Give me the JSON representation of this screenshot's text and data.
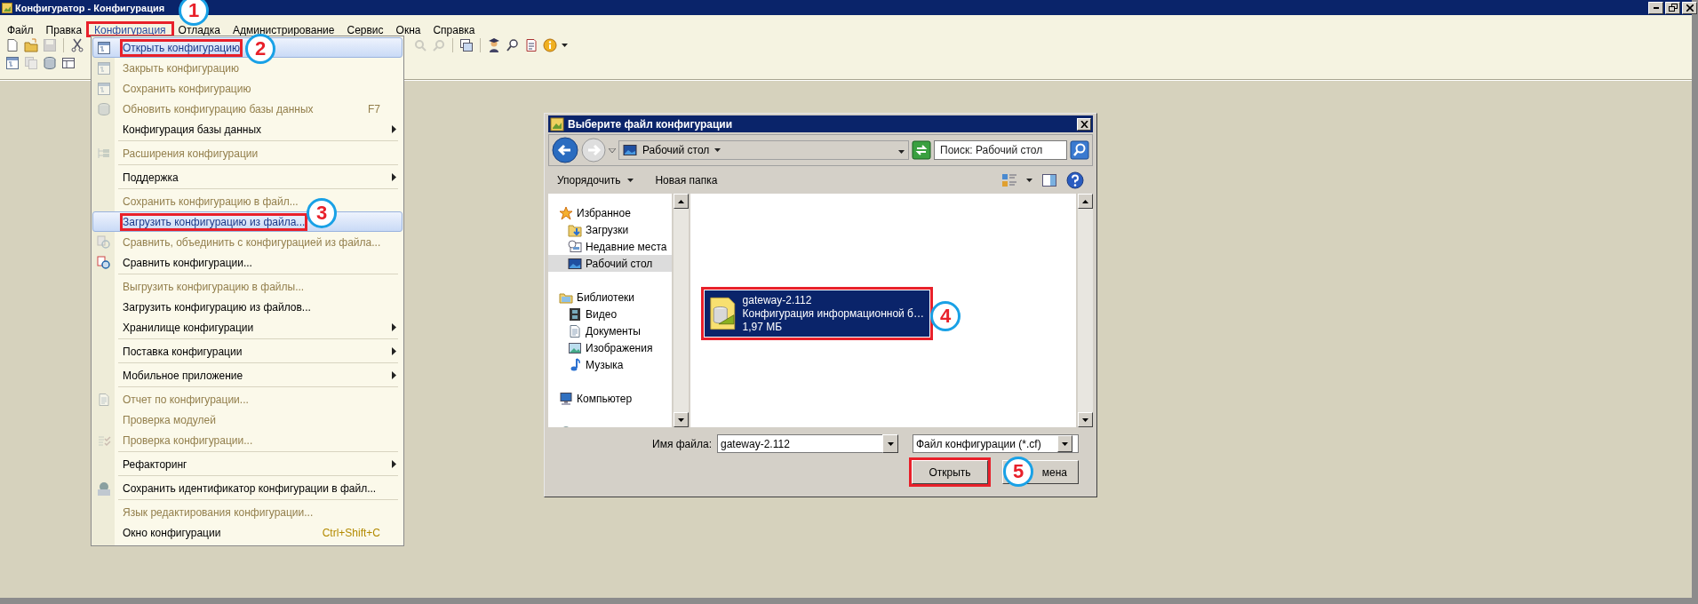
{
  "window": {
    "title": "Конфигуратор - Конфигурация"
  },
  "menu_bar": [
    {
      "label": "Файл",
      "selected": false,
      "outlined": false
    },
    {
      "label": "Правка",
      "selected": false,
      "outlined": false
    },
    {
      "label": "Конфигурация",
      "selected": true,
      "outlined": true
    },
    {
      "label": "Отладка",
      "selected": false,
      "outlined": false
    },
    {
      "label": "Администрирование",
      "selected": false,
      "outlined": false
    },
    {
      "label": "Сервис",
      "selected": false,
      "outlined": false
    },
    {
      "label": "Окна",
      "selected": false,
      "outlined": false
    },
    {
      "label": "Справка",
      "selected": false,
      "outlined": false
    }
  ],
  "config_menu": {
    "items": [
      {
        "kind": "item",
        "label": "Открыть конфигурацию",
        "disabled": false,
        "selected": true,
        "outlined": true
      },
      {
        "kind": "item",
        "label": "Закрыть конфигурацию",
        "disabled": true,
        "selected": false,
        "outlined": false
      },
      {
        "kind": "item",
        "label": "Сохранить конфигурацию",
        "disabled": true,
        "selected": false,
        "outlined": false
      },
      {
        "kind": "item",
        "label": "Обновить конфигурацию базы данных",
        "shortcut": "F7",
        "disabled": true,
        "selected": false,
        "outlined": false
      },
      {
        "kind": "submenu",
        "label": "Конфигурация базы данных",
        "disabled": false,
        "selected": false,
        "outlined": false
      },
      {
        "kind": "separator"
      },
      {
        "kind": "item",
        "label": "Расширения конфигурации",
        "disabled": true,
        "selected": false,
        "outlined": false
      },
      {
        "kind": "separator"
      },
      {
        "kind": "submenu",
        "label": "Поддержка",
        "disabled": false,
        "selected": false,
        "outlined": false
      },
      {
        "kind": "separator"
      },
      {
        "kind": "item",
        "label": "Сохранить конфигурацию в файл...",
        "disabled": true,
        "selected": false,
        "outlined": false
      },
      {
        "kind": "item",
        "label": "Загрузить конфигурацию из файла...",
        "disabled": false,
        "selected": true,
        "outlined": true
      },
      {
        "kind": "item",
        "label": "Сравнить, объединить с конфигурацией из файла...",
        "disabled": true,
        "selected": false,
        "outlined": false
      },
      {
        "kind": "item",
        "label": "Сравнить конфигурации...",
        "disabled": false,
        "selected": false,
        "outlined": false
      },
      {
        "kind": "separator"
      },
      {
        "kind": "item",
        "label": "Выгрузить конфигурацию в файлы...",
        "disabled": true,
        "selected": false,
        "outlined": false
      },
      {
        "kind": "item",
        "label": "Загрузить конфигурацию из файлов...",
        "disabled": false,
        "selected": false,
        "outlined": false
      },
      {
        "kind": "submenu",
        "label": "Хранилище конфигурации",
        "disabled": false,
        "selected": false,
        "outlined": false
      },
      {
        "kind": "separator"
      },
      {
        "kind": "submenu",
        "label": "Поставка конфигурации",
        "disabled": false,
        "selected": false,
        "outlined": false
      },
      {
        "kind": "separator"
      },
      {
        "kind": "submenu",
        "label": "Мобильное приложение",
        "disabled": false,
        "selected": false,
        "outlined": false
      },
      {
        "kind": "separator"
      },
      {
        "kind": "item",
        "label": "Отчет по конфигурации...",
        "disabled": true,
        "selected": false,
        "outlined": false
      },
      {
        "kind": "item",
        "label": "Проверка модулей",
        "disabled": true,
        "selected": false,
        "outlined": false
      },
      {
        "kind": "item",
        "label": "Проверка конфигурации...",
        "disabled": true,
        "selected": false,
        "outlined": false
      },
      {
        "kind": "separator"
      },
      {
        "kind": "submenu",
        "label": "Рефакторинг",
        "disabled": false,
        "selected": false,
        "outlined": false
      },
      {
        "kind": "separator"
      },
      {
        "kind": "item",
        "label": "Сохранить идентификатор конфигурации в файл...",
        "disabled": false,
        "selected": false,
        "outlined": false
      },
      {
        "kind": "separator"
      },
      {
        "kind": "item",
        "label": "Язык редактирования конфигурации...",
        "disabled": true,
        "selected": false,
        "outlined": false
      },
      {
        "kind": "item",
        "label": "Окно конфигурации",
        "shortcut": "Ctrl+Shift+C",
        "disabled": false,
        "selected": false,
        "outlined": false
      }
    ]
  },
  "dialog": {
    "title": "Выберите файл конфигурации",
    "location": "Рабочий стол",
    "search": {
      "placeholder": "Поиск: Рабочий стол"
    },
    "commands": [
      {
        "label": "Упорядочить",
        "dropdown": true
      },
      {
        "label": "Новая папка",
        "dropdown": false
      }
    ],
    "nav": [
      {
        "label": "Избранное",
        "selected": false,
        "children": [
          {
            "label": "Загрузки",
            "selected": false
          },
          {
            "label": "Недавние места",
            "selected": false
          },
          {
            "label": "Рабочий стол",
            "selected": true
          }
        ]
      },
      {
        "label": "Библиотеки",
        "selected": false,
        "children": [
          {
            "label": "Видео",
            "selected": false
          },
          {
            "label": "Документы",
            "selected": false
          },
          {
            "label": "Изображения",
            "selected": false
          },
          {
            "label": "Музыка",
            "selected": false
          }
        ]
      },
      {
        "label": "Компьютер",
        "selected": false
      }
    ],
    "files": [
      {
        "name": "gateway-2.112",
        "type": "Конфигурация информационной б…",
        "size": "1,97 МБ",
        "selected": true,
        "outlined": true
      }
    ],
    "file_name": {
      "label": "Имя файла:",
      "value": "gateway-2.112"
    },
    "filter": "Файл конфигурации (*.cf)",
    "buttons": [
      {
        "label": "Открыть",
        "outlined": true
      },
      {
        "label": "мена",
        "outlined": false
      }
    ]
  },
  "callouts": [
    {
      "number": "1"
    },
    {
      "number": "2"
    },
    {
      "number": "3"
    },
    {
      "number": "4"
    },
    {
      "number": "5"
    }
  ]
}
